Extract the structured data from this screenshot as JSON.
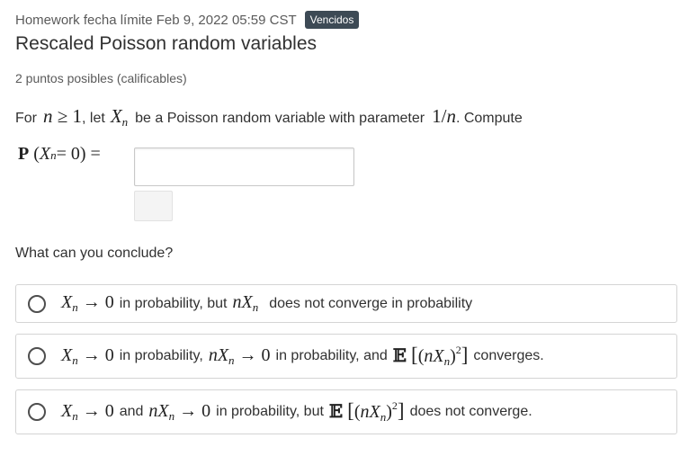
{
  "header": {
    "text": "Homework fecha límite Feb 9, 2022 05:59 CST",
    "badge": "Vencidos"
  },
  "problem": {
    "title": "Rescaled Poisson random variables",
    "points": "2 puntos posibles (calificables)",
    "prompt_for": "For",
    "prompt_let": ", let",
    "prompt_mid": "be a Poisson random variable with parameter",
    "prompt_end": ". Compute"
  },
  "answer": {
    "value": "",
    "placeholder": ""
  },
  "question": "What can you conclude?",
  "choices": {
    "c1": {
      "t1": "in probability, but",
      "t2": "does not converge in probability"
    },
    "c2": {
      "t1": "in probability,",
      "t2": "in probability, and",
      "t3": "converges."
    },
    "c3": {
      "t1": "and",
      "t2": "in probability, but",
      "t3": "does not converge."
    }
  },
  "colors": {
    "badge_bg": "#3d4a55",
    "text": "#313131",
    "muted": "#5a5a5a",
    "border": "#d4d4d4"
  }
}
